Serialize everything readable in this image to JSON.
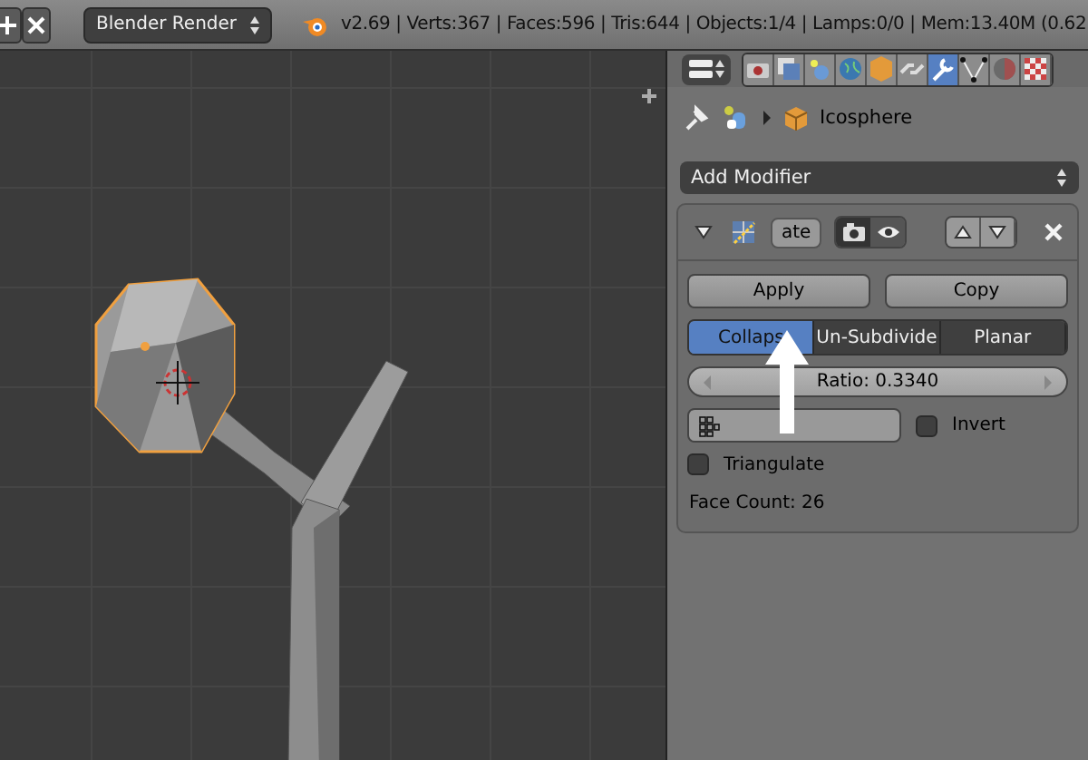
{
  "header": {
    "render_engine": "Blender Render",
    "stats": "v2.69 | Verts:367 | Faces:596 | Tris:644 | Objects:1/4 | Lamps:0/0 | Mem:13.40M (0.62"
  },
  "properties_tabs": [
    {
      "kind": "render",
      "selected": false
    },
    {
      "kind": "layers",
      "selected": false
    },
    {
      "kind": "scene",
      "selected": false
    },
    {
      "kind": "world",
      "selected": false
    },
    {
      "kind": "object",
      "selected": false
    },
    {
      "kind": "constraints",
      "selected": false
    },
    {
      "kind": "modifiers",
      "selected": true
    },
    {
      "kind": "data",
      "selected": false
    },
    {
      "kind": "material",
      "selected": false
    },
    {
      "kind": "texture",
      "selected": false
    }
  ],
  "breadcrumb": {
    "object": "Icosphere"
  },
  "add_modifier": "Add Modifier",
  "modifier": {
    "name": "ate",
    "expanded": true,
    "apply": "Apply",
    "copy": "Copy",
    "modes": [
      {
        "label": "Collaps",
        "selected": true
      },
      {
        "label": "Un-Subdivide",
        "selected": false
      },
      {
        "label": "Planar",
        "selected": false
      }
    ],
    "ratio": "Ratio: 0.3340",
    "invert": {
      "label": "Invert",
      "checked": false
    },
    "triangulate": {
      "label": "Triangulate",
      "checked": false
    },
    "face_count": "Face Count: 26"
  }
}
